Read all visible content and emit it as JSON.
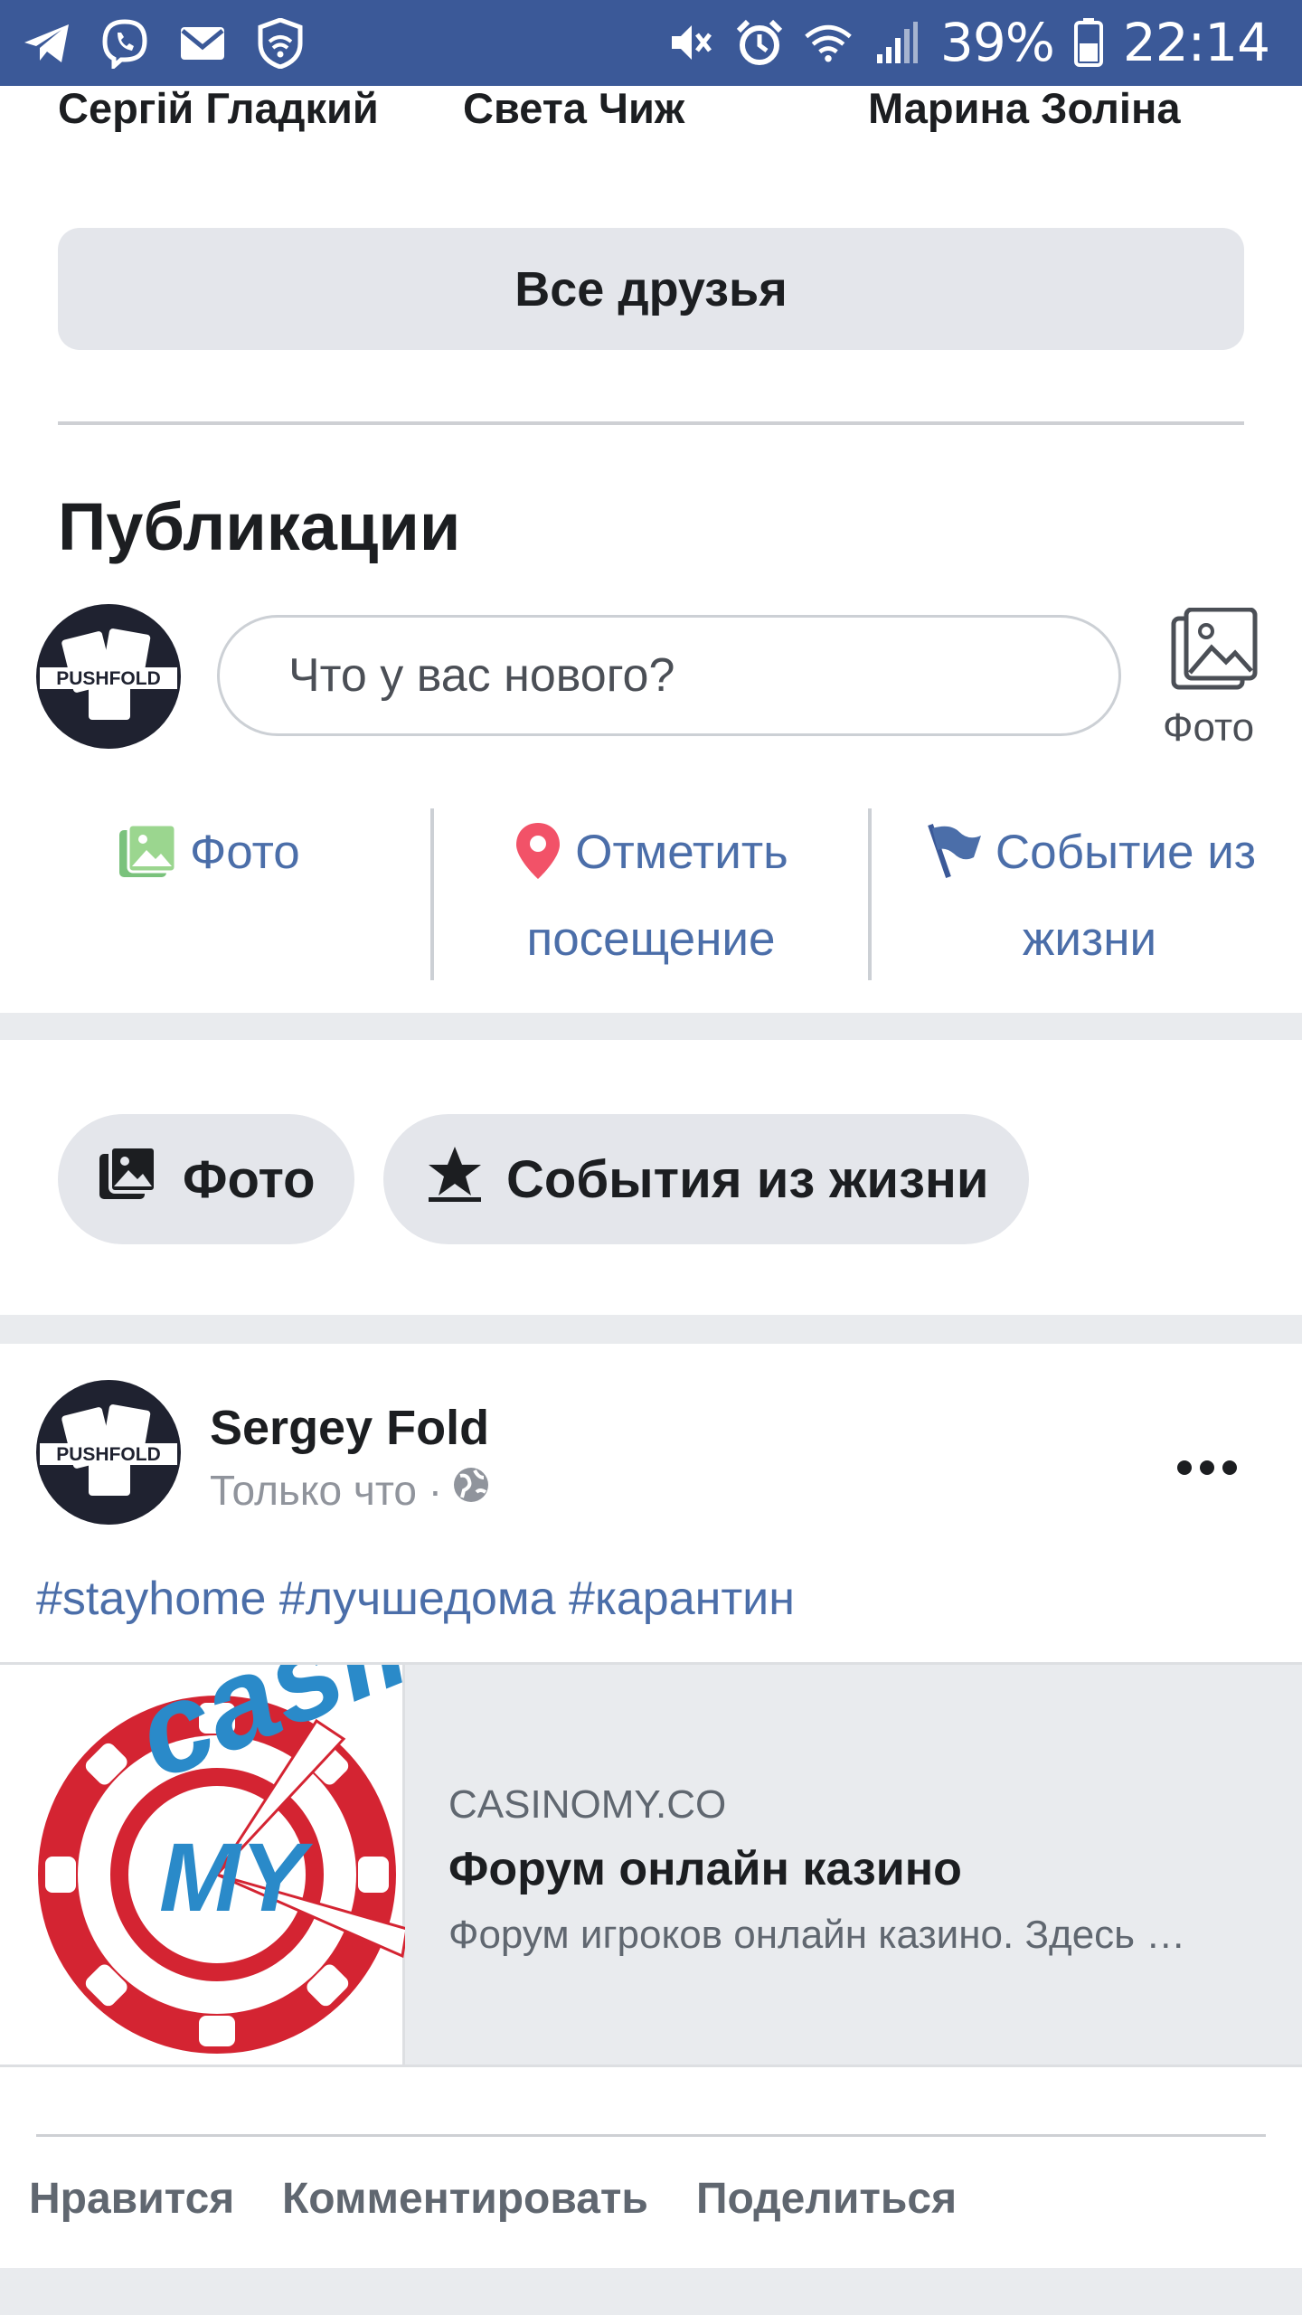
{
  "status_bar": {
    "icons_left": [
      "telegram-icon",
      "viber-icon",
      "mail-icon",
      "shield-icon"
    ],
    "icons_right": [
      "mute-icon",
      "alarm-icon",
      "wifi-icon",
      "signal-icon",
      "battery-icon"
    ],
    "battery": "39%",
    "time": "22:14"
  },
  "friends": {
    "names": [
      "Сергій Гладкий",
      "Света Чиж",
      "Марина Золіна"
    ],
    "all_button": "Все друзья"
  },
  "publications": {
    "title": "Публикации",
    "composer_placeholder": "Что у вас нового?",
    "photo_label": "Фото",
    "actions": {
      "photo": "Фото",
      "checkin_line1": "Отметить",
      "checkin_line2": "посещение",
      "life_event_line1": "Событие из",
      "life_event_line2": "жизни"
    },
    "filters": {
      "photo": "Фото",
      "life_events": "События из жизни"
    }
  },
  "post": {
    "author": "Sergey Fold",
    "time": "Только что ·",
    "avatar_text": "PUSHFOLD",
    "text": "#stayhome #лучшедома #карантин",
    "link": {
      "domain": "CASINOMY.CO",
      "title": "Форум онлайн казино",
      "description": "Форум игроков онлайн казино. Здесь …",
      "image_text_casino": "casino",
      "image_text_my": "MY"
    },
    "footer": {
      "like": "Нравится",
      "comment": "Комментировать",
      "share": "Поделиться"
    }
  },
  "colors": {
    "status_bar": "#3b5998",
    "link_blue": "#4b6ea9",
    "chip_red": "#d42432",
    "casino_blue": "#2a8ac9"
  }
}
